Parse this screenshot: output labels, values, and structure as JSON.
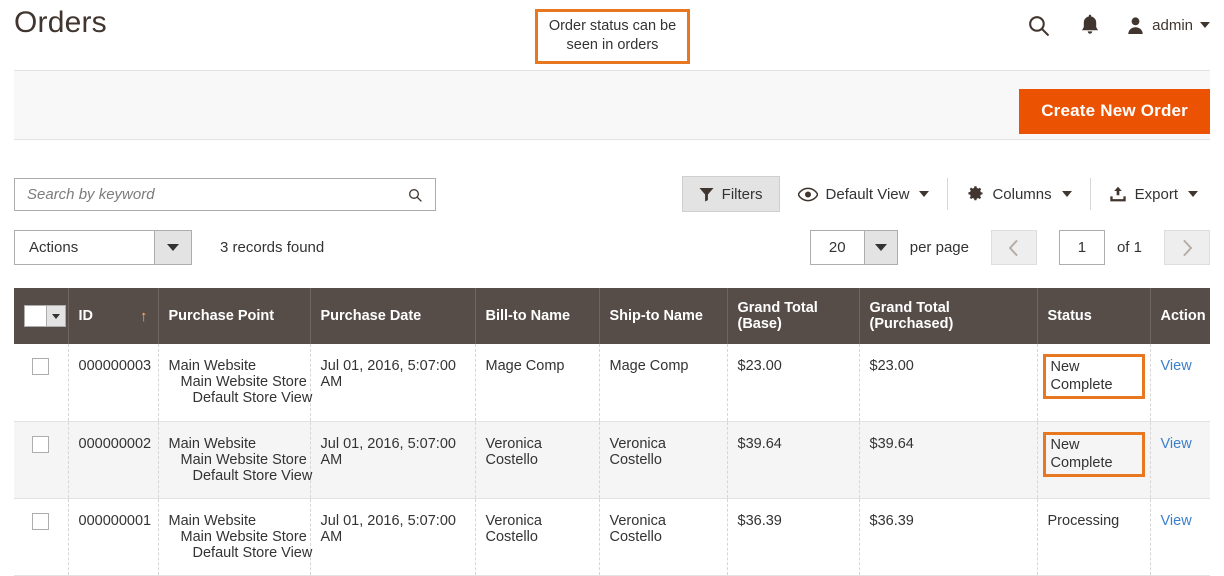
{
  "header": {
    "title": "Orders",
    "callout_text": "Order status can be seen in orders",
    "search_icon": "search-icon",
    "notifications_icon": "bell-icon",
    "user_icon": "user-avatar-icon",
    "admin_label": "admin"
  },
  "action_band": {
    "create_order_label": "Create New Order"
  },
  "toolbar": {
    "search_placeholder": "Search by keyword",
    "search_value": "",
    "search_button_icon": "search-icon",
    "filters_label": "Filters",
    "filters_icon": "funnel-icon",
    "default_view_label": "Default View",
    "default_view_icon": "eye-icon",
    "columns_label": "Columns",
    "columns_icon": "gear-icon",
    "export_label": "Export",
    "export_icon": "upload-icon"
  },
  "subtoolbar": {
    "actions_label": "Actions",
    "records_found": "3 records found",
    "per_page_value": "20",
    "per_page_label": "per page",
    "prev_page_icon": "chevron-left-icon",
    "next_page_icon": "chevron-right-icon",
    "current_page": "1",
    "of_pages": "of 1"
  },
  "grid": {
    "columns": [
      {
        "key": "check",
        "label": ""
      },
      {
        "key": "id",
        "label": "ID",
        "sort": "↑"
      },
      {
        "key": "purchase_point",
        "label": "Purchase Point"
      },
      {
        "key": "purchase_date",
        "label": "Purchase Date"
      },
      {
        "key": "bill_to",
        "label": "Bill-to Name"
      },
      {
        "key": "ship_to",
        "label": "Ship-to Name"
      },
      {
        "key": "grand_total_base",
        "label": "Grand Total (Base)"
      },
      {
        "key": "grand_total_purchased",
        "label": "Grand Total (Purchased)"
      },
      {
        "key": "status",
        "label": "Status"
      },
      {
        "key": "action",
        "label": "Action"
      }
    ],
    "rows": [
      {
        "id": "000000003",
        "purchase_point_1": "Main Website",
        "purchase_point_2": "Main Website Store",
        "purchase_point_3": "Default Store View",
        "purchase_date": "Jul 01, 2016, 5:07:00 AM",
        "bill_to": "Mage Comp",
        "ship_to": "Mage Comp",
        "grand_total_base": "$23.00",
        "grand_total_purchased": "$23.00",
        "status": "New Complete",
        "status_highlighted": true,
        "action": "View"
      },
      {
        "id": "000000002",
        "purchase_point_1": "Main Website",
        "purchase_point_2": "Main Website Store",
        "purchase_point_3": "Default Store View",
        "purchase_date": "Jul 01, 2016, 5:07:00 AM",
        "bill_to": "Veronica Costello",
        "ship_to": "Veronica Costello",
        "grand_total_base": "$39.64",
        "grand_total_purchased": "$39.64",
        "status": "New Complete",
        "status_highlighted": true,
        "action": "View"
      },
      {
        "id": "000000001",
        "purchase_point_1": "Main Website",
        "purchase_point_2": "Main Website Store",
        "purchase_point_3": "Default Store View",
        "purchase_date": "Jul 01, 2016, 5:07:00 AM",
        "bill_to": "Veronica Costello",
        "ship_to": "Veronica Costello",
        "grand_total_base": "$36.39",
        "grand_total_purchased": "$36.39",
        "status": "Processing",
        "status_highlighted": false,
        "action": "View"
      }
    ]
  },
  "colors": {
    "accent_orange": "#eb5202",
    "highlight_orange": "#e87722",
    "header_brown": "#574d48",
    "link_blue": "#3b7fcc"
  }
}
